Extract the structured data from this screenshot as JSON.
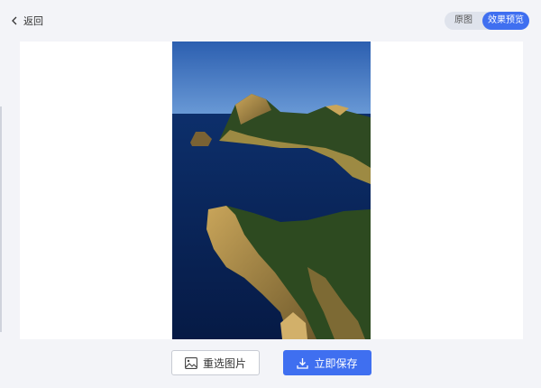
{
  "header": {
    "back_label": "返回",
    "view_toggle": {
      "original_label": "原图",
      "preview_label": "效果预览",
      "selected": "效果预览"
    }
  },
  "preview": {
    "image_description_icon": "photo"
  },
  "actions": {
    "reselect_label": "重选图片",
    "save_label": "立即保存"
  },
  "colors": {
    "accent": "#3f6ff0",
    "background": "#f3f4f8"
  }
}
